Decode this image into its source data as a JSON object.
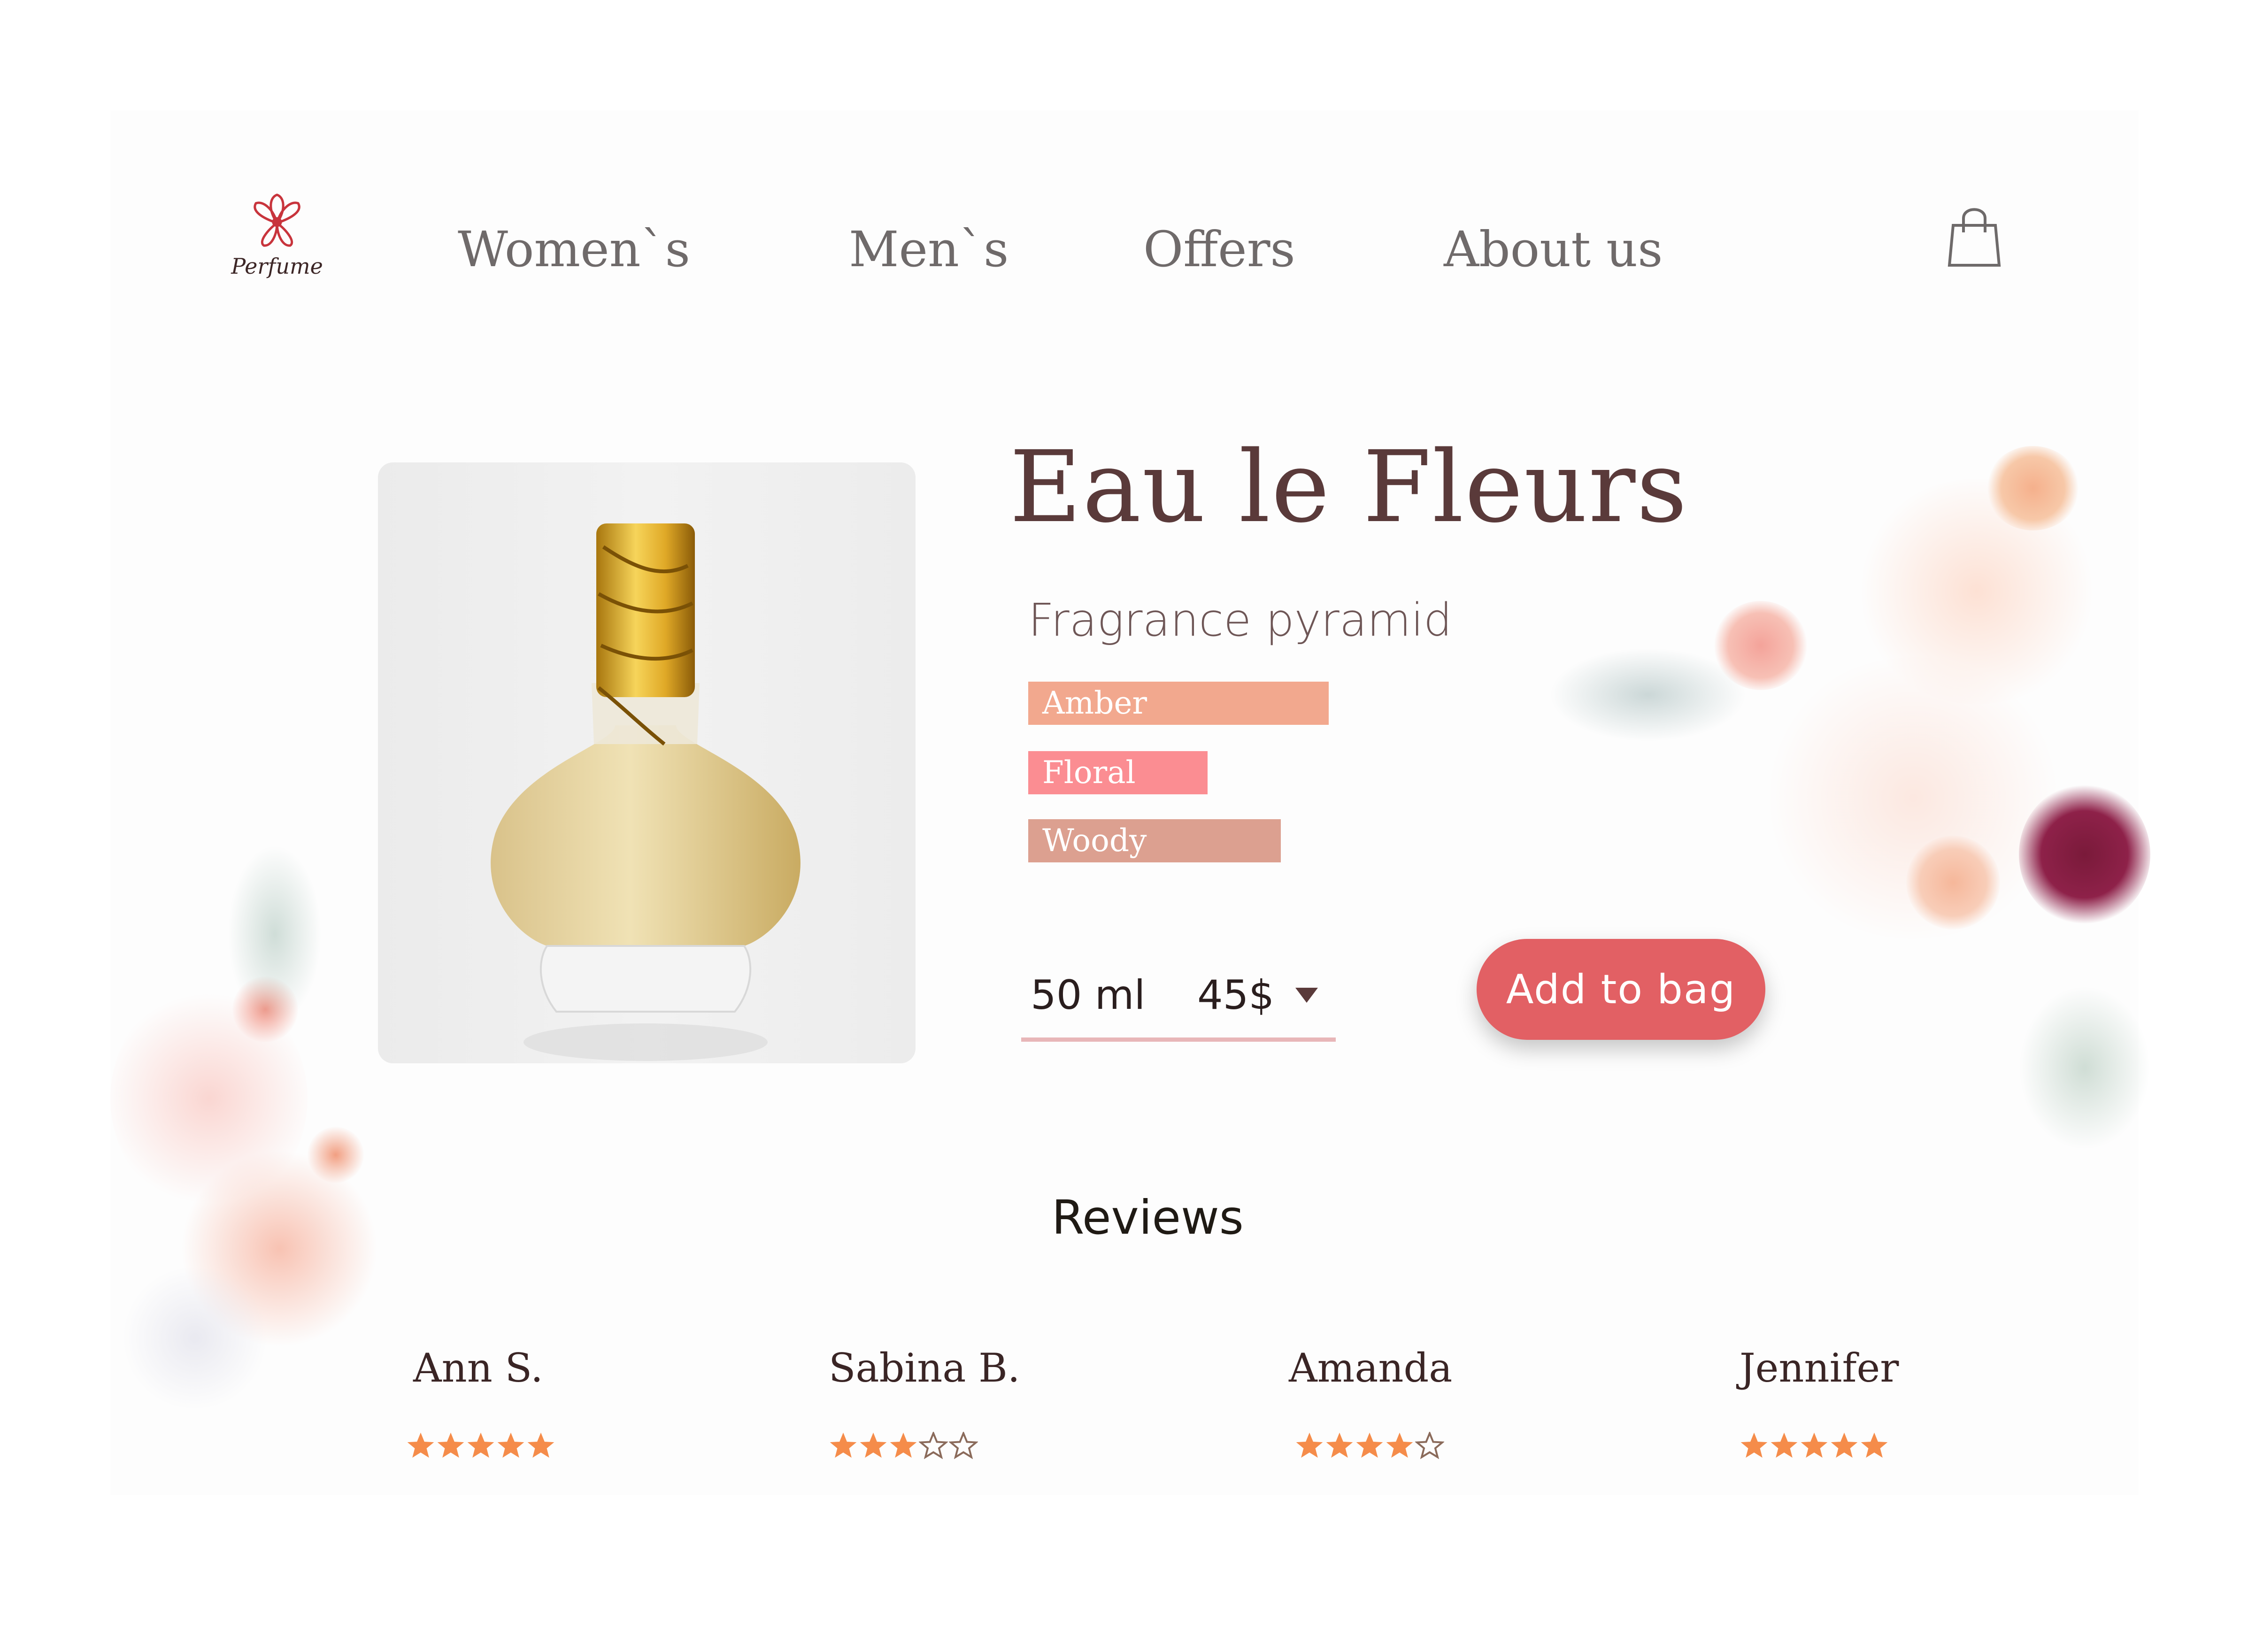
{
  "brand": {
    "logo_text": "Perfume"
  },
  "nav": {
    "items": [
      {
        "label": "Women`s"
      },
      {
        "label": "Men`s"
      },
      {
        "label": "Offers"
      },
      {
        "label": "About us"
      }
    ],
    "bag_icon": "shopping-bag-icon"
  },
  "product": {
    "name": "Eau le Fleurs",
    "pyramid_title": "Fragrance pyramid",
    "notes": [
      {
        "label": "Amber",
        "color": "#f2a88e"
      },
      {
        "label": "Floral",
        "color": "#fb8d92"
      },
      {
        "label": "Woody",
        "color": "#dca090"
      }
    ],
    "size": {
      "volume": "50 ml",
      "price": "45$"
    },
    "add_button": "Add to bag"
  },
  "reviews": {
    "title": "Reviews",
    "items": [
      {
        "name": "Ann S.",
        "rating": 5
      },
      {
        "name": "Sabina B.",
        "rating": 3
      },
      {
        "name": "Amanda",
        "rating": 4
      },
      {
        "name": "Jennifer",
        "rating": 5
      }
    ]
  },
  "colors": {
    "accent": "#e26064",
    "star": "#f58c4a",
    "text_dark": "#5a3a3a"
  }
}
